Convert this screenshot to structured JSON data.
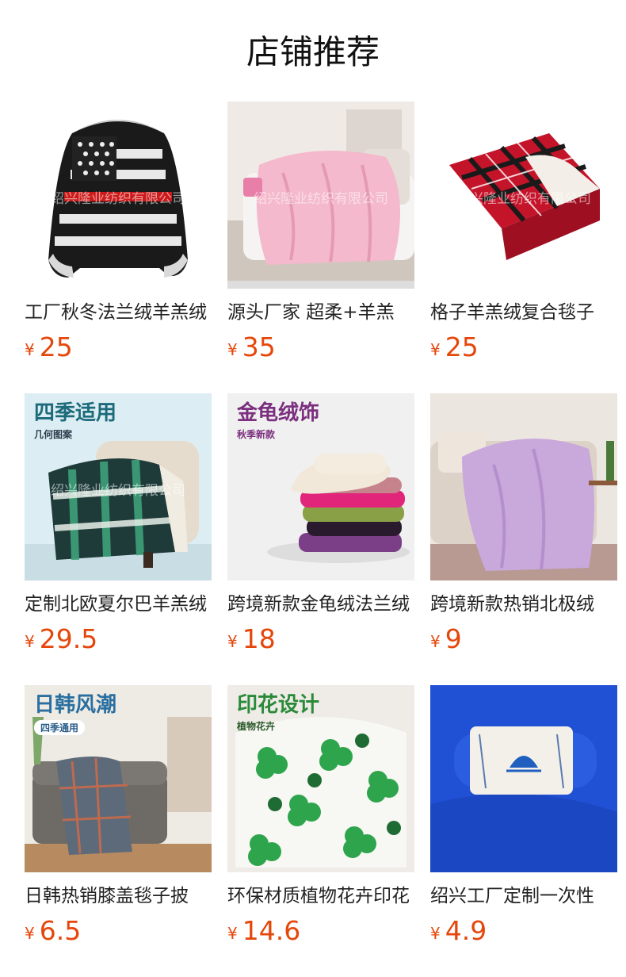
{
  "header": {
    "title": "店铺推荐"
  },
  "currency_symbol": "¥",
  "products": [
    {
      "name": "工厂秋冬法兰绒羊羔绒",
      "price": "25",
      "watermark": "绍兴隆业纺织有限公司",
      "image": "hooded-flag-blanket"
    },
    {
      "name": "源头厂家 超柔+羊羔",
      "price": "35",
      "watermark": "绍兴隆业纺织有限公司",
      "image": "pink-blanket-sofa"
    },
    {
      "name": "格子羊羔绒复合毯子",
      "price": "25",
      "watermark": "绍兴隆业纺织有限公司",
      "image": "red-plaid-blanket"
    },
    {
      "name": "定制北欧夏尔巴羊羔绒",
      "price": "29.5",
      "watermark": "绍兴隆业纺织有限公司",
      "image": "green-plaid-chair",
      "tag_title": "四季适用",
      "tag_sub": "几何图案"
    },
    {
      "name": "跨境新款金龟绒法兰绒",
      "price": "18",
      "image": "stacked-blankets",
      "tag_title": "金龟绒饰",
      "tag_sub": "秋季新款"
    },
    {
      "name": "跨境新款热销北极绒",
      "price": "9",
      "image": "lilac-blanket-sofa"
    },
    {
      "name": "日韩热销膝盖毯子披",
      "price": "6.5",
      "image": "plaid-blanket-livingroom",
      "tag_title": "日韩风潮",
      "tag_sub": "四季通用"
    },
    {
      "name": "环保材质植物花卉印花",
      "price": "14.6",
      "image": "clover-print-blanket",
      "tag_title": "印花设计",
      "tag_sub": "植物花卉"
    },
    {
      "name": "绍兴工厂定制一次性",
      "price": "4.9",
      "image": "blue-fleece-roll"
    }
  ]
}
